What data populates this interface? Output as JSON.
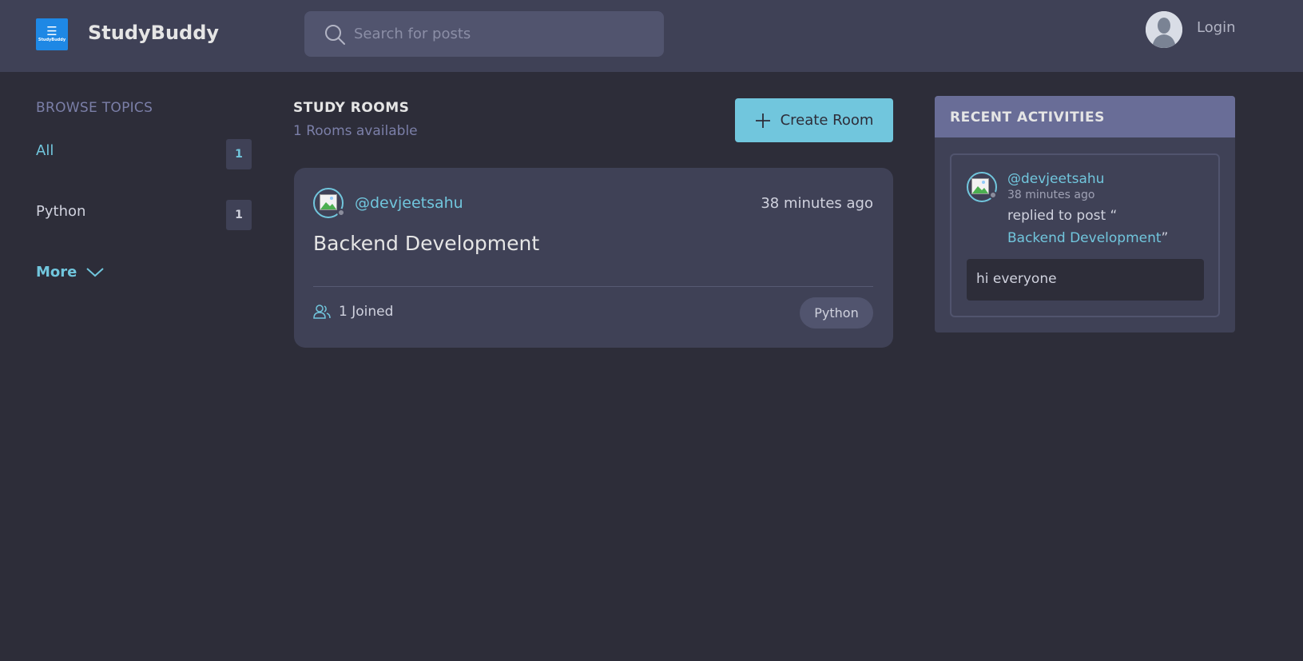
{
  "header": {
    "logo_glyph": "☰",
    "logo_text": "StudyBuddy",
    "brand": "StudyBuddy",
    "search_placeholder": "Search for posts",
    "login_label": "Login"
  },
  "sidebar": {
    "title": "BROWSE TOPICS",
    "topics": [
      {
        "name": "All",
        "count": "1",
        "active": true
      },
      {
        "name": "Python",
        "count": "1",
        "active": false
      }
    ],
    "more_label": "More"
  },
  "rooms": {
    "title": "STUDY ROOMS",
    "subtitle": "1 Rooms available",
    "create_label": "Create Room",
    "items": [
      {
        "host": "@devjeetsahu",
        "time": "38 minutes ago",
        "name": "Backend Development",
        "joined": "1 Joined",
        "topic": "Python"
      }
    ]
  },
  "activity": {
    "title": "RECENT ACTIVITIES",
    "items": [
      {
        "user": "@devjeetsahu",
        "time": "38 minutes ago",
        "action": "replied to post “",
        "room": "Backend Development",
        "close_quote": "”",
        "message": "hi everyone"
      }
    ]
  },
  "colors": {
    "background": "#2d2d39",
    "panel": "#3f4156",
    "accent": "#71c6dd",
    "muted": "#7b7fa8",
    "activity_header": "#696d97",
    "logo_blue": "#1e88e5"
  },
  "icons": [
    "search-icon",
    "user-avatar-icon",
    "chevron-down-icon",
    "plus-icon",
    "users-icon",
    "broken-image-icon"
  ]
}
